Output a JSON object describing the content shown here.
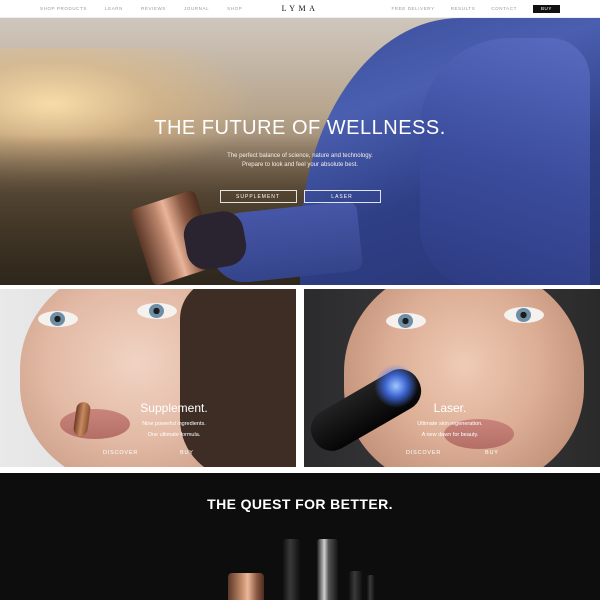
{
  "nav": {
    "left_links": [
      "Shop Products",
      "Learn",
      "Reviews",
      "Journal",
      "Shop"
    ],
    "logo": "LYMA",
    "right_links": [
      "Free Delivery",
      "Results",
      "Contact"
    ],
    "buy_label": "BUY"
  },
  "hero": {
    "title": "THE FUTURE OF WELLNESS.",
    "subtitle_line1": "The perfect balance of science, nature and technology.",
    "subtitle_line2": "Prepare to look and feel your absolute best.",
    "buttons": [
      "SUPPLEMENT",
      "LASER"
    ]
  },
  "cards": [
    {
      "title": "Supplement.",
      "desc_line1": "Nine powerful ingredients.",
      "desc_line2": "One ultimate formula.",
      "discover_label": "DISCOVER",
      "buy_label": "BUY"
    },
    {
      "title": "Laser.",
      "desc_line1": "Ultimate skin regeneration.",
      "desc_line2": "A new dawn for beauty.",
      "discover_label": "DISCOVER",
      "buy_label": "BUY"
    }
  ],
  "quest": {
    "title": "THE QUEST FOR BETTER."
  }
}
